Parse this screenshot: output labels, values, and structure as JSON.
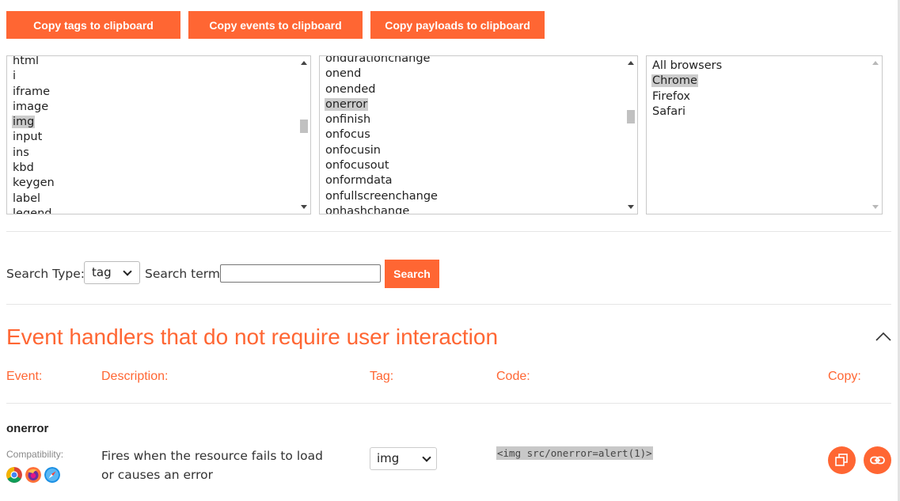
{
  "toolbar": {
    "copy_tags": "Copy tags to clipboard",
    "copy_events": "Copy events to clipboard",
    "copy_payloads": "Copy payloads to clipboard"
  },
  "tags_list": {
    "items": [
      "html",
      "i",
      "iframe",
      "image",
      "img",
      "input",
      "ins",
      "kbd",
      "keygen",
      "label",
      "legend"
    ],
    "selected": "img"
  },
  "events_list": {
    "items": [
      "ondurationchange",
      "onend",
      "onended",
      "onerror",
      "onfinish",
      "onfocus",
      "onfocusin",
      "onfocusout",
      "onformdata",
      "onfullscreenchange",
      "onhashchange"
    ],
    "selected": "onerror"
  },
  "browsers_list": {
    "items": [
      "All browsers",
      "Chrome",
      "Firefox",
      "Safari"
    ],
    "selected": "Chrome"
  },
  "search": {
    "type_label": "Search Type:",
    "type_value": "tag",
    "term_label": "Search term:",
    "term_value": "",
    "button_label": "Search"
  },
  "section": {
    "title": "Event handlers that do not require user interaction",
    "expanded": true
  },
  "table": {
    "headers": {
      "event": "Event:",
      "description": "Description:",
      "tag": "Tag:",
      "code": "Code:",
      "copy": "Copy:"
    },
    "rows": [
      {
        "event": "onerror",
        "compatibility_label": "Compatibility:",
        "browsers": [
          "chrome-icon",
          "firefox-icon",
          "safari-icon"
        ],
        "description": "Fires when the resource fails to load or causes an error",
        "tag": "img",
        "code": "<img src/onerror=alert(1)>"
      }
    ]
  },
  "colors": {
    "accent": "#ff6633",
    "selection": "#cccccc",
    "code_bg": "#c8c8c8"
  }
}
